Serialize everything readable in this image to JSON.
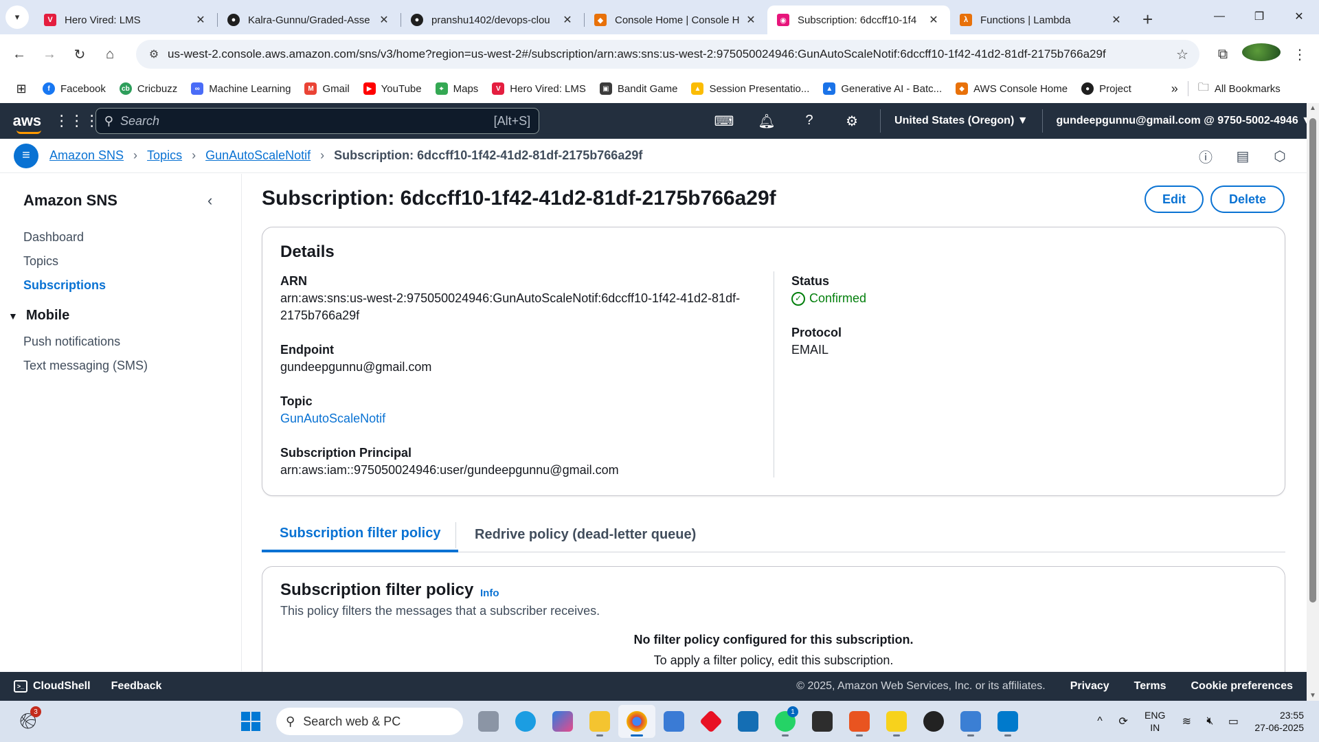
{
  "browser": {
    "tabs": [
      {
        "title": "Hero Vired: LMS",
        "favicon_color": "#e41e3f",
        "favicon": "V"
      },
      {
        "title": "Kalra-Gunnu/Graded-Asse",
        "favicon_color": "#1f1f1f",
        "favicon": "gh"
      },
      {
        "title": "pranshu1402/devops-clou",
        "favicon_color": "#1f1f1f",
        "favicon": "gh"
      },
      {
        "title": "Console Home | Console H",
        "favicon_color": "#e8710a",
        "favicon": "◆"
      },
      {
        "title": "Subscription: 6dccff10-1f4",
        "favicon_color": "#e7157b",
        "favicon": "◉",
        "active": true
      },
      {
        "title": "Functions | Lambda",
        "favicon_color": "#e8710a",
        "favicon": "λ"
      }
    ],
    "url": "us-west-2.console.aws.amazon.com/sns/v3/home?region=us-west-2#/subscription/arn:aws:sns:us-west-2:975050024946:GunAutoScaleNotif:6dccff10-1f42-41d2-81df-2175b766a29f",
    "bookmarks": [
      {
        "label": "Facebook",
        "color": "#1877f2"
      },
      {
        "label": "Cricbuzz",
        "color": "#2e9e5b"
      },
      {
        "label": "Machine Learning",
        "color": "#4a6cf7"
      },
      {
        "label": "Gmail",
        "color": "#ea4335"
      },
      {
        "label": "YouTube",
        "color": "#ff0000"
      },
      {
        "label": "Maps",
        "color": "#34a853"
      },
      {
        "label": "Hero Vired: LMS",
        "color": "#e41e3f"
      },
      {
        "label": "Bandit Game",
        "color": "#3b3b3b"
      },
      {
        "label": "Session Presentatio...",
        "color": "#fbbc04"
      },
      {
        "label": "Generative AI - Batc...",
        "color": "#1a73e8"
      },
      {
        "label": "AWS Console Home",
        "color": "#e8710a"
      },
      {
        "label": "Project",
        "color": "#1f1f1f"
      }
    ],
    "all_bookmarks": "All Bookmarks"
  },
  "aws": {
    "logo": "aws",
    "search_placeholder": "Search",
    "search_shortcut": "[Alt+S]",
    "region": "United States (Oregon) ▼",
    "account": "gundeepgunnu@gmail.com @ 9750-5002-4946 ▼"
  },
  "breadcrumb": {
    "items": [
      "Amazon SNS",
      "Topics",
      "GunAutoScaleNotif"
    ],
    "current": "Subscription: 6dccff10-1f42-41d2-81df-2175b766a29f"
  },
  "sidebar": {
    "title": "Amazon SNS",
    "items": [
      "Dashboard",
      "Topics",
      "Subscriptions"
    ],
    "section": "Mobile",
    "section_items": [
      "Push notifications",
      "Text messaging (SMS)"
    ]
  },
  "main": {
    "title": "Subscription: 6dccff10-1f42-41d2-81df-2175b766a29f",
    "edit_label": "Edit",
    "delete_label": "Delete",
    "details": {
      "heading": "Details",
      "arn_label": "ARN",
      "arn_line1": "arn:aws:sns:us-west-2:975050024946:GunAutoScaleNotif:6dccff10-1f42-41d2-81df-",
      "arn_line2": "2175b766a29f",
      "endpoint_label": "Endpoint",
      "endpoint": "gundeepgunnu@gmail.com",
      "topic_label": "Topic",
      "topic": "GunAutoScaleNotif",
      "principal_label": "Subscription Principal",
      "principal": "arn:aws:iam::975050024946:user/gundeepgunnu@gmail.com",
      "status_label": "Status",
      "status": "Confirmed",
      "protocol_label": "Protocol",
      "protocol": "EMAIL"
    },
    "tabs": [
      "Subscription filter policy",
      "Redrive policy (dead-letter queue)"
    ],
    "policy": {
      "heading": "Subscription filter policy",
      "info": "Info",
      "description": "This policy filters the messages that a subscriber receives.",
      "empty_title": "No filter policy configured for this subscription.",
      "empty_text": "To apply a filter policy, edit this subscription."
    }
  },
  "footer": {
    "cloudshell": "CloudShell",
    "feedback": "Feedback",
    "copyright": "© 2025, Amazon Web Services, Inc. or its affiliates.",
    "privacy": "Privacy",
    "terms": "Terms",
    "cookies": "Cookie preferences"
  },
  "taskbar": {
    "search_placeholder": "Search web & PC",
    "badge_count": "3",
    "whatsapp_badge": "1",
    "lang_line1": "ENG",
    "lang_line2": "IN",
    "time": "23:55",
    "date": "27-06-2025"
  }
}
